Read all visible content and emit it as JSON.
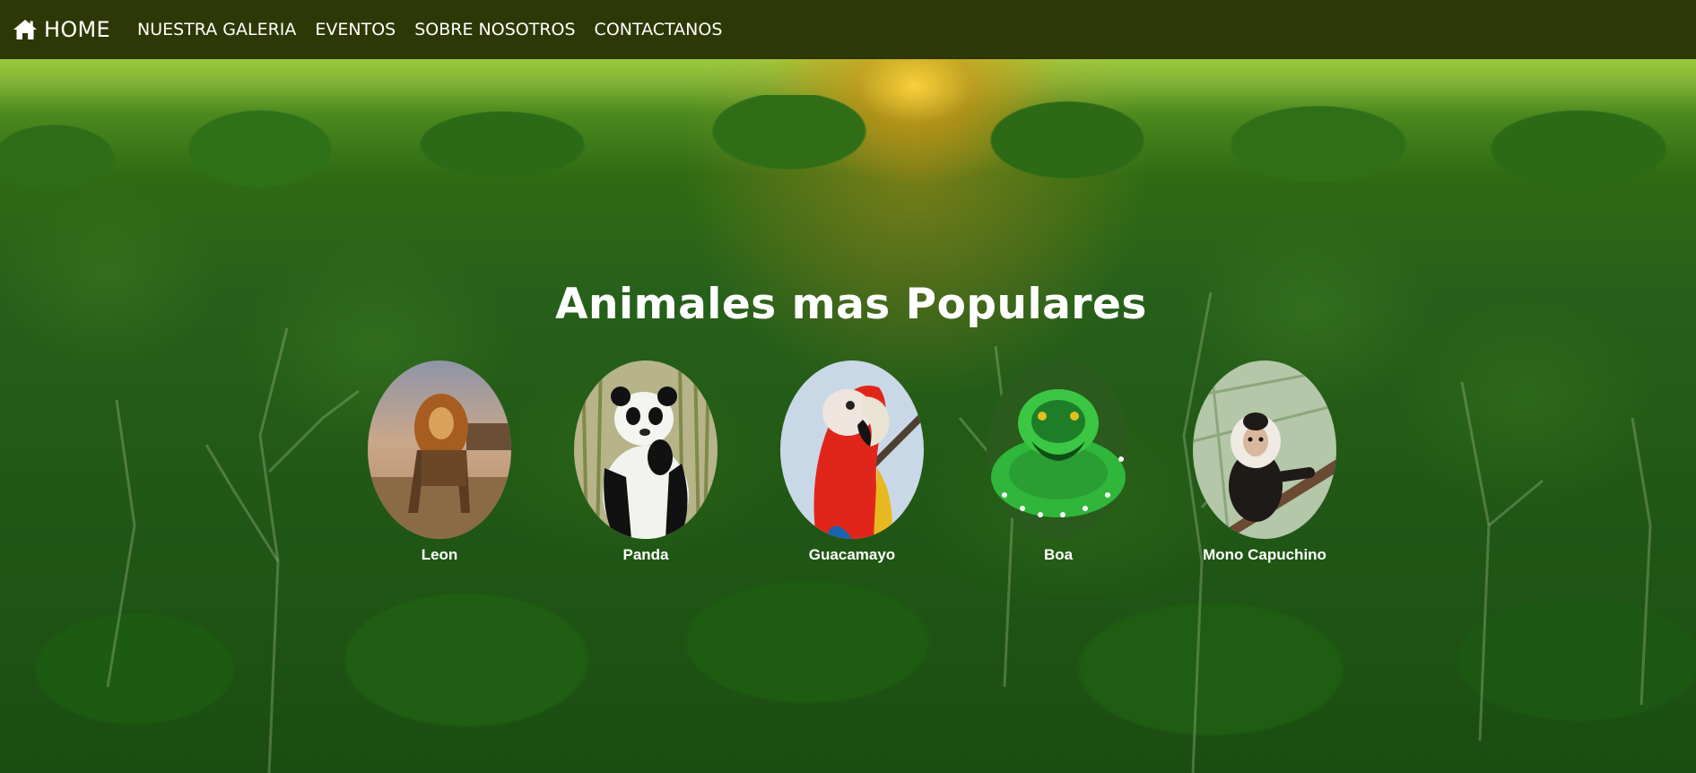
{
  "navbar": {
    "brand_label": "HOME",
    "brand_icon": "home-icon",
    "links": [
      {
        "label": "NUESTRA GALERIA"
      },
      {
        "label": "EVENTOS"
      },
      {
        "label": "SOBRE NOSOTROS"
      },
      {
        "label": "CONTACTANOS"
      }
    ]
  },
  "main": {
    "title": "Animales mas Populares",
    "animals": [
      {
        "name": "Leon"
      },
      {
        "name": "Panda"
      },
      {
        "name": "Guacamayo"
      },
      {
        "name": "Boa"
      },
      {
        "name": "Mono Capuchino"
      }
    ]
  },
  "colors": {
    "navbar_bg": "#2d3806",
    "text": "#ffffff",
    "forest": "#225a16"
  }
}
